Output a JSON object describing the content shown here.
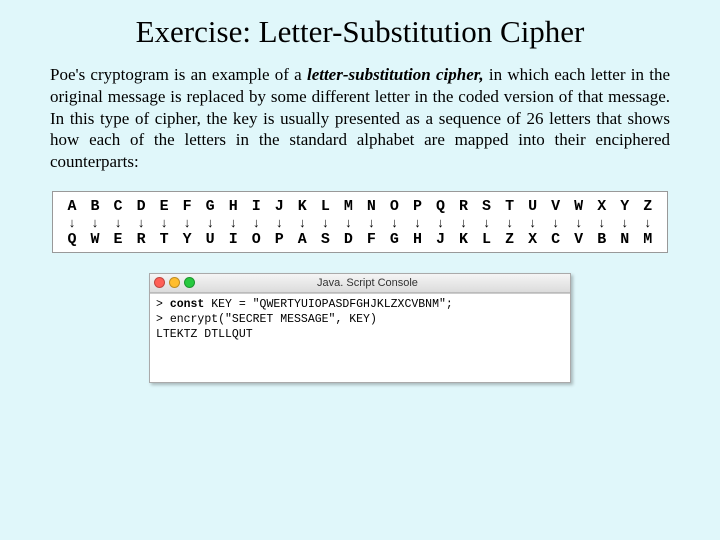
{
  "title": "Exercise: Letter-Substitution Cipher",
  "paragraph": {
    "pre": "Poe's cryptogram is an example of a ",
    "em": "letter-substitution cipher,",
    "post": " in which each letter in the original message is replaced by some different letter in the coded version of that message.  In this type of cipher, the key is usually presented as a sequence of 26 letters that shows how each of the letters in the standard alphabet are mapped into their enciphered counterparts:"
  },
  "cipher": {
    "plain": [
      "A",
      "B",
      "C",
      "D",
      "E",
      "F",
      "G",
      "H",
      "I",
      "J",
      "K",
      "L",
      "M",
      "N",
      "O",
      "P",
      "Q",
      "R",
      "S",
      "T",
      "U",
      "V",
      "W",
      "X",
      "Y",
      "Z"
    ],
    "arrow": "↓",
    "coded": [
      "Q",
      "W",
      "E",
      "R",
      "T",
      "Y",
      "U",
      "I",
      "O",
      "P",
      "A",
      "S",
      "D",
      "F",
      "G",
      "H",
      "J",
      "K",
      "L",
      "Z",
      "X",
      "C",
      "V",
      "B",
      "N",
      "M"
    ]
  },
  "console": {
    "title": "Java. Script Console",
    "prompt": "> ",
    "kw_const": "const",
    "line1_rest": " KEY = \"QWERTYUIOPASDFGHJKLZXCVBNM\";",
    "line2": "encrypt(\"SECRET MESSAGE\", KEY)",
    "output": "LTEKTZ DTLLQUT"
  }
}
